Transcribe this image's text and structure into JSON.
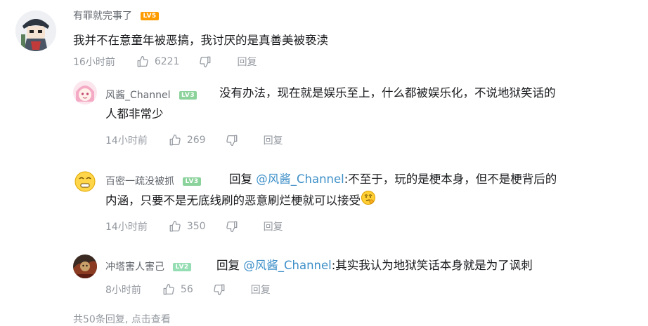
{
  "main_comment": {
    "username": "有罪就完事了",
    "level": "LV5",
    "level_color": "#ff9c00",
    "text": "我并不在意童年被恶搞，我讨厌的是真善美被亵渎",
    "time": "16小时前",
    "likes": "6221",
    "reply_label": "回复"
  },
  "replies": [
    {
      "username": "风酱_Channel",
      "level": "LV3",
      "level_color": "#8bd29b",
      "prefix": "",
      "mention": "",
      "text_line1": "没有办法，现在就是娱乐至上，什么都被娱乐化，不说地狱笑话的",
      "text_line2": "人都非常少",
      "time": "14小时前",
      "likes": "269",
      "reply_label": "回复"
    },
    {
      "username": "百密一疏没被抓",
      "level": "LV3",
      "level_color": "#8bd29b",
      "prefix": "回复 ",
      "mention": "@风酱_Channel",
      "text_line1": ":不至于，玩的是梗本身，但不是梗背后的",
      "text_line2": "内涵，只要不是无底线刷的恶意刷烂梗就可以接受",
      "time": "14小时前",
      "likes": "350",
      "reply_label": "回复"
    },
    {
      "username": "冲塔害人害己",
      "level": "LV2",
      "level_color": "#95ddb2",
      "prefix": "回复 ",
      "mention": "@风酱_Channel",
      "text_line1": ":其实我认为地狱笑话本身就是为了讽刺",
      "time": "8小时前",
      "likes": "56",
      "reply_label": "回复"
    }
  ],
  "footer": {
    "more_text": "共50条回复, 点击查看"
  },
  "icons": {
    "like": "thumbs-up-icon",
    "dislike": "thumbs-down-icon",
    "emoji": "thinking-emoji-icon"
  }
}
